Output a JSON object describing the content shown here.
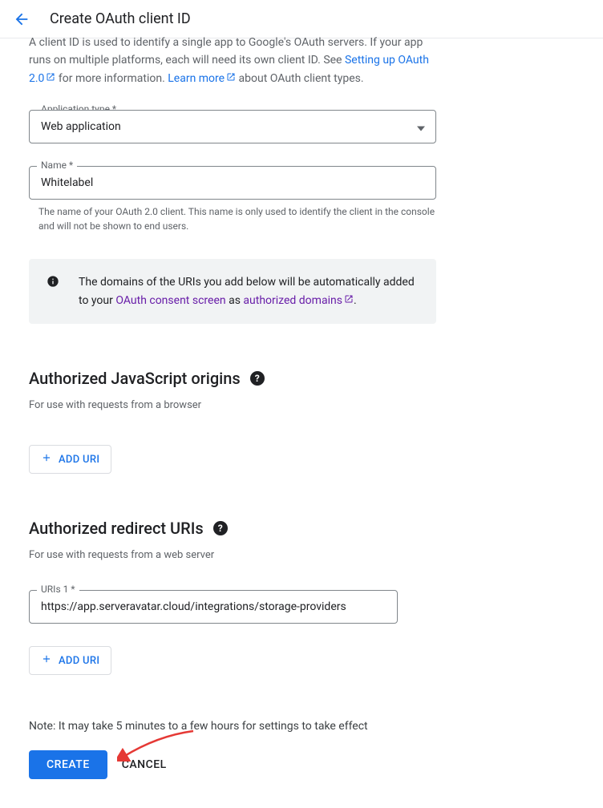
{
  "header": {
    "title": "Create OAuth client ID"
  },
  "intro": {
    "line1_pre": "A client ID is used to identify a single app to Google's OAuth servers. If your app runs on multiple platforms, each will need its own client ID. See ",
    "link1": "Setting up OAuth 2.0",
    "line1_mid": " for more information. ",
    "link2": "Learn more",
    "line1_post": " about OAuth client types."
  },
  "app_type": {
    "label": "Application type *",
    "value": "Web application"
  },
  "name_field": {
    "label": "Name *",
    "value": "Whitelabel",
    "helper": "The name of your OAuth 2.0 client. This name is only used to identify the client in the console and will not be shown to end users."
  },
  "info_box": {
    "text_pre": "The domains of the URIs you add below will be automatically added to your ",
    "link1": "OAuth consent screen",
    "text_mid": " as ",
    "link2": "authorized domains",
    "text_post": "."
  },
  "js_origins": {
    "title": "Authorized JavaScript origins",
    "sub": "For use with requests from a browser",
    "add_btn": "ADD URI"
  },
  "redirect_uris": {
    "title": "Authorized redirect URIs",
    "sub": "For use with requests from a web server",
    "uri1_label": "URIs 1 *",
    "uri1_value": "https://app.serveravatar.cloud/integrations/storage-providers",
    "add_btn": "ADD URI"
  },
  "note": "Note: It may take 5 minutes to a few hours for settings to take effect",
  "buttons": {
    "create": "CREATE",
    "cancel": "CANCEL"
  }
}
